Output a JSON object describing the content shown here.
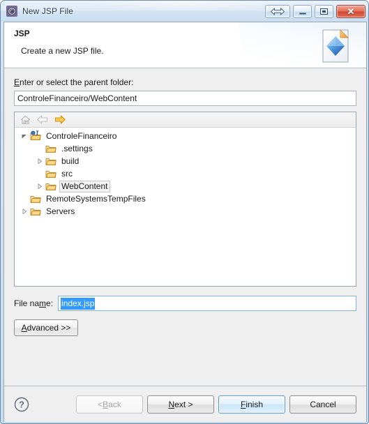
{
  "window": {
    "title": "New JSP File",
    "icon": "gear-icon",
    "controls": [
      {
        "name": "resize-button",
        "glyph": "double-arrow"
      },
      {
        "name": "minimize-button",
        "glyph": "minimize"
      },
      {
        "name": "maximize-button",
        "glyph": "maximize"
      },
      {
        "name": "close-button",
        "glyph": "✕"
      }
    ]
  },
  "header": {
    "title": "JSP",
    "description": "Create a new JSP file.",
    "icon": "jsp-file-icon"
  },
  "parent_folder": {
    "label_pre": "",
    "label_mnemonic": "E",
    "label_post": "nter or select the parent folder:",
    "value": "ControleFinanceiro/WebContent"
  },
  "tree_toolbar": [
    {
      "name": "home-icon",
      "enabled": false
    },
    {
      "name": "back-arrow-icon",
      "enabled": false
    },
    {
      "name": "forward-arrow-icon",
      "enabled": true
    }
  ],
  "tree": [
    {
      "label": "ControleFinanceiro",
      "indent": 0,
      "twisty": "expanded",
      "icon": "java-project-folder-icon",
      "selected": false
    },
    {
      "label": ".settings",
      "indent": 1,
      "twisty": "none",
      "icon": "folder-icon",
      "selected": false
    },
    {
      "label": "build",
      "indent": 1,
      "twisty": "collapsed",
      "icon": "folder-icon",
      "selected": false
    },
    {
      "label": "src",
      "indent": 1,
      "twisty": "none",
      "icon": "folder-icon",
      "selected": false
    },
    {
      "label": "WebContent",
      "indent": 1,
      "twisty": "collapsed",
      "icon": "folder-icon",
      "selected": true
    },
    {
      "label": "RemoteSystemsTempFiles",
      "indent": 0,
      "twisty": "none",
      "icon": "folder-icon",
      "selected": false
    },
    {
      "label": "Servers",
      "indent": 0,
      "twisty": "collapsed",
      "icon": "folder-icon",
      "selected": false
    }
  ],
  "filename": {
    "label_pre": "File na",
    "label_mnemonic": "m",
    "label_post": "e:",
    "value": "index.jsp",
    "selected": true
  },
  "advanced": {
    "label_mnemonic": "A",
    "label_post": "dvanced >>"
  },
  "buttons": {
    "help": "?",
    "back": {
      "pre": "< ",
      "mnemonic": "B",
      "post": "ack",
      "enabled": false
    },
    "next": {
      "pre": "",
      "mnemonic": "N",
      "post": "ext >",
      "enabled": true
    },
    "finish": {
      "pre": "",
      "mnemonic": "F",
      "post": "inish",
      "enabled": true,
      "default": true
    },
    "cancel": {
      "pre": "Cancel",
      "mnemonic": "",
      "post": "",
      "enabled": true
    }
  },
  "colors": {
    "accent": "#3399ff",
    "default_button_border": "#5a9ad0",
    "close_button": "#cf4632",
    "folder": "#f0b24a",
    "diamond": "#2a6fd4"
  }
}
